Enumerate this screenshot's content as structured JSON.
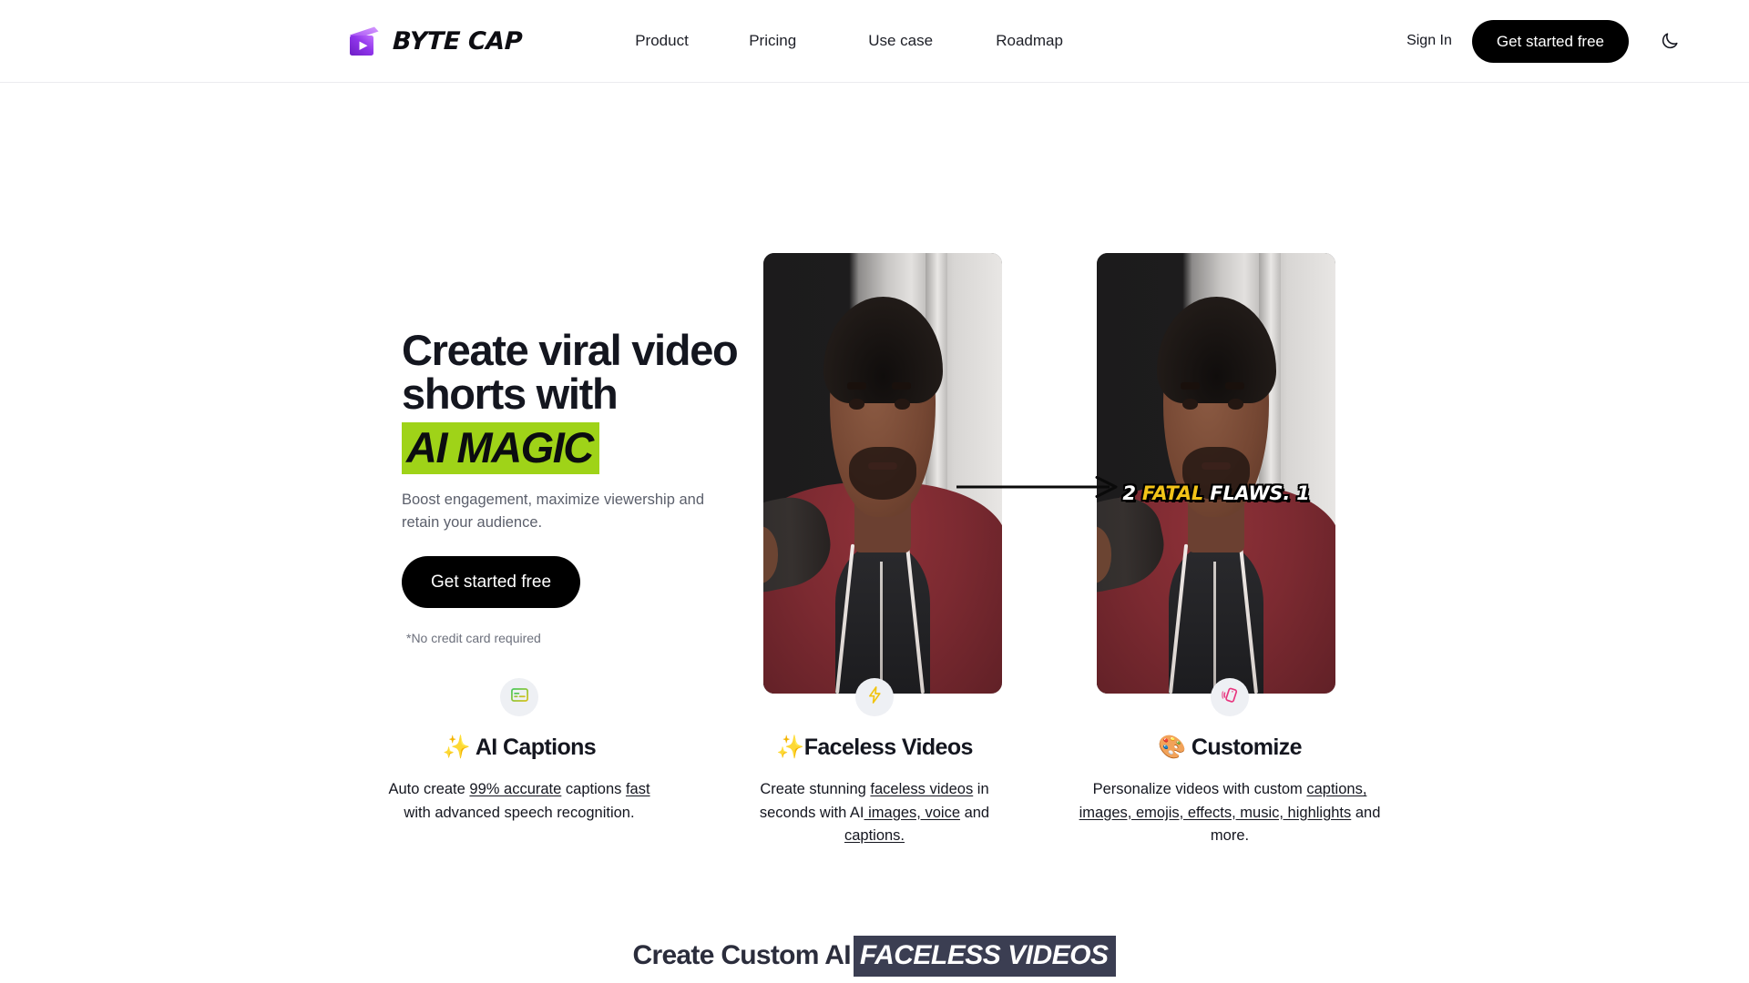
{
  "brand": {
    "name": "BYTE CAP",
    "logo_icon": "video-clapperboard-play-icon",
    "logo_colors": {
      "from": "#b249f8",
      "to": "#7a2bd4"
    }
  },
  "nav": {
    "links": [
      {
        "label": "Product"
      },
      {
        "label": "Pricing"
      },
      {
        "label": "Use case"
      },
      {
        "label": "Roadmap"
      }
    ],
    "sign_in_label": "Sign In",
    "cta_label": "Get started free",
    "theme_toggle_icon": "moon-icon"
  },
  "hero": {
    "headline_line1": "Create viral video",
    "headline_line2": "shorts with",
    "headline_highlight": "AI MAGIC",
    "highlight_color": "#9fd318",
    "subcopy": "Boost engagement, maximize viewership and retain your audience.",
    "cta_label": "Get started free",
    "fineprint": "*No credit card required",
    "media": {
      "left_card_alt": "original-video-frame",
      "right_card_alt": "captioned-video-frame",
      "arrow_icon": "arrow-right-icon",
      "caption": {
        "part1": "2 ",
        "highlight": "FATAL",
        "part2": " FLAWS. 1",
        "highlight_color": "#f2c318"
      }
    }
  },
  "features": [
    {
      "icon": "captions-icon",
      "icon_color": "#4cc35e",
      "emoji": "✨",
      "title": " AI Captions",
      "desc_parts": [
        {
          "text": "Auto create ",
          "underline": false
        },
        {
          "text": "99% accurate",
          "underline": true
        },
        {
          "text": " captions ",
          "underline": false
        },
        {
          "text": "fast",
          "underline": true
        },
        {
          "text": " with advanced speech recognition.",
          "underline": false
        }
      ]
    },
    {
      "icon": "lightning-bolt-icon",
      "icon_color": "#f3c623",
      "emoji": "✨",
      "title": "Faceless Videos",
      "desc_parts": [
        {
          "text": "Create stunning ",
          "underline": false
        },
        {
          "text": "faceless videos",
          "underline": true
        },
        {
          "text": " in seconds with AI",
          "underline": false
        },
        {
          "text": " images, voice",
          "underline": true
        },
        {
          "text": " and ",
          "underline": false
        },
        {
          "text": "captions.",
          "underline": true
        }
      ]
    },
    {
      "icon": "vibrating-phone-icon",
      "icon_color": "#e8357f",
      "emoji": "🎨",
      "title": " Customize",
      "desc_parts": [
        {
          "text": "Personalize videos with custom ",
          "underline": false
        },
        {
          "text": "captions,",
          "underline": true
        },
        {
          "text": " ",
          "underline": false
        },
        {
          "text": "images, emojis, effects, music, highlights",
          "underline": true
        },
        {
          "text": " and more.",
          "underline": false
        }
      ]
    }
  ],
  "bottom": {
    "title_prefix": "Create Custom AI",
    "title_highlight": "FACELESS VIDEOS",
    "highlight_bg": "#3b3e52"
  }
}
